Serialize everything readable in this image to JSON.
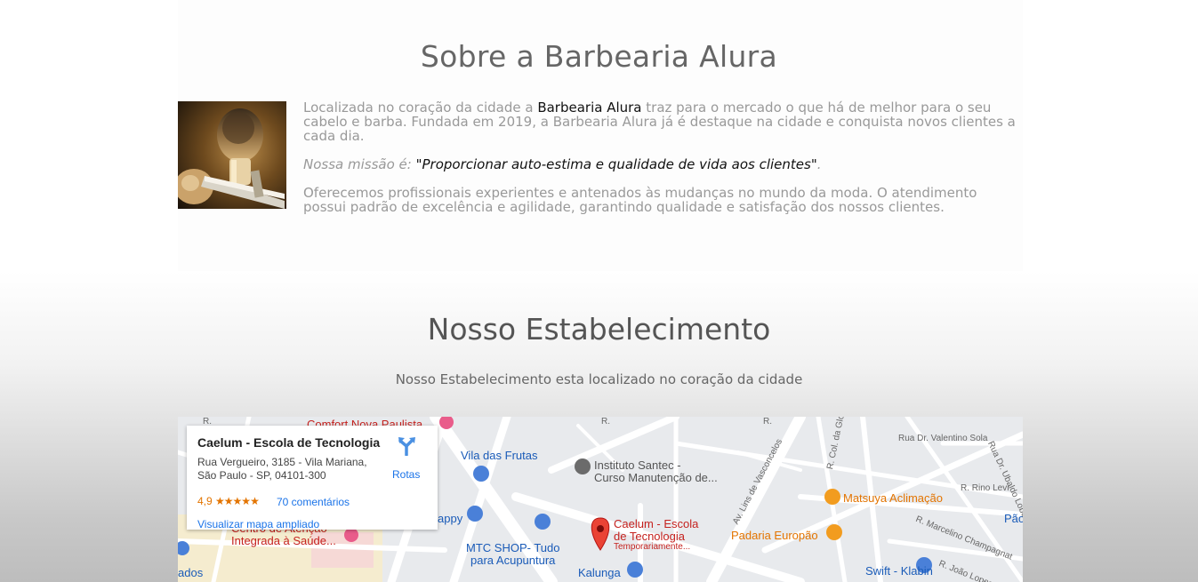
{
  "about": {
    "title": "Sobre a Barbearia Alura",
    "p1_before": "Localizada no coração da cidade a ",
    "p1_strong": "Barbearia Alura",
    "p1_after": " traz para o mercado o que há de melhor para o seu cabelo e barba. Fundada em 2019, a Barbearia Alura já é destaque na cidade e conquista novos clientes a cada dia.",
    "mission_label": "Nossa missão é: ",
    "mission_quote": "\"Proporcionar auto-estima e qualidade de vida aos clientes\"",
    "mission_end": ".",
    "p3": "Oferecemos profissionais experientes e antenados às mudanças no mundo da moda. O atendimento possui padrão de excelência e agilidade, garantindo qualidade e satisfação dos nossos clientes."
  },
  "establishment": {
    "title": "Nosso Estabelecimento",
    "subtitle": "Nosso Estabelecimento esta localizado no coração da cidade"
  },
  "map": {
    "card": {
      "title": "Caelum - Escola de Tecnologia",
      "address_line1": "Rua Vergueiro, 3185 - Vila Mariana,",
      "address_line2": "São Paulo - SP, 04101-300",
      "rating": "4,9",
      "stars": "★★★★★",
      "reviews": "70 comentários",
      "larger_map": "Visualizar mapa ampliado",
      "directions": "Rotas"
    },
    "labels": {
      "comfort": "Comfort Nova Paulista",
      "vila_frutas": "Vila das Frutas",
      "instituto_1": "Instituto Santec -",
      "instituto_2": "Curso Manutenção de...",
      "happy": "appy",
      "centro_1": "Centro de Atenção",
      "centro_2": "Integrada à Saúde...",
      "mtc_1": "MTC SHOP- Tudo",
      "mtc_2": "para Acupuntura",
      "caelum_1": "Caelum - Escola",
      "caelum_2": "de Tecnologia",
      "caelum_3": "Temporariamente...",
      "kalunga": "Kalunga",
      "matsuya": "Matsuya Aclimação",
      "padaria": "Padaria Europão",
      "swift": "Swift - Klabin",
      "ados": "ados",
      "pao": "Pão",
      "av_lins": "Av. Lins de Vasconcelos",
      "valentino": "Rua Dr. Valentino Sola",
      "rino": "R. Rino Levi",
      "marcelino": "R. Marcelino Champagnat",
      "gloria": "R. Col. da Glória",
      "ubaldo": "Rua Dr. Ubaldo Lobo",
      "joao_lopes": "R. João Lopes",
      "r1": "R.",
      "r2": "R.",
      "r3": "R."
    },
    "colors": {
      "marker": "#ea4335",
      "shop": "#4a80d8",
      "food": "#f29c1f",
      "road": "#ffffff",
      "block": "#e8eaed"
    }
  }
}
